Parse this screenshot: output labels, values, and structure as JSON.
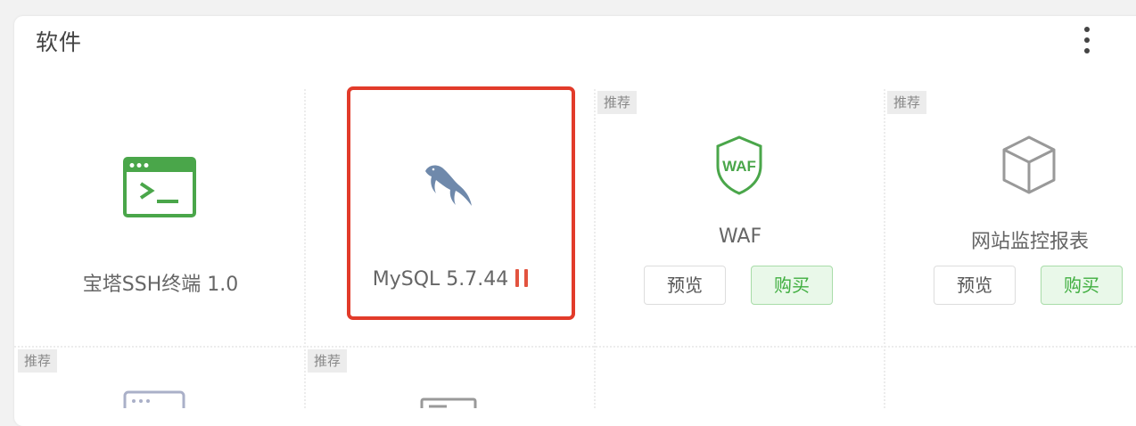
{
  "panel": {
    "title": "软件"
  },
  "recommend_tag": "推荐",
  "cards": [
    {
      "name": "宝塔SSH终端 1.0",
      "icon": "terminal-icon",
      "recommended": false
    },
    {
      "name": "MySQL 5.7.44",
      "icon": "mysql-dolphin-icon",
      "status": "stopped",
      "status_icon": "pause-icon",
      "highlighted": true
    },
    {
      "name": "WAF",
      "icon": "waf-shield-icon",
      "recommended": true,
      "preview_label": "预览",
      "buy_label": "购买"
    },
    {
      "name": "网站监控报表",
      "icon": "cube-icon",
      "recommended": true,
      "preview_label": "预览",
      "buy_label": "购买"
    }
  ],
  "row2": [
    {
      "icon": "server-icon",
      "recommended": true
    },
    {
      "icon": "monitor-icon",
      "recommended": true
    }
  ],
  "colors": {
    "green": "#3fae3f",
    "highlight": "#e23b2a",
    "status_stopped": "#e2533f"
  }
}
